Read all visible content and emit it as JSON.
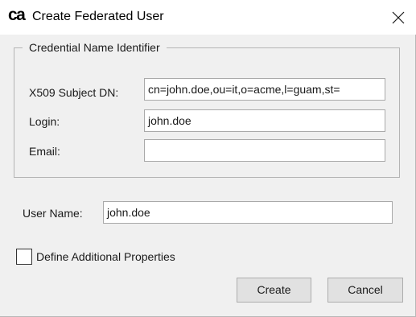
{
  "window": {
    "title": "Create Federated User",
    "logo_text": "ca",
    "close_icon": "close-icon"
  },
  "credential_group": {
    "legend": "Credential Name Identifier",
    "x509_label": "X509 Subject DN:",
    "x509_value": "cn=john.doe,ou=it,o=acme,l=guam,st=",
    "login_label": "Login:",
    "login_value": "john.doe",
    "email_label": "Email:",
    "email_value": ""
  },
  "user_name": {
    "label": "User Name:",
    "value": "john.doe"
  },
  "additional": {
    "label": "Define Additional Properties",
    "checked": false
  },
  "buttons": {
    "create": "Create",
    "cancel": "Cancel"
  }
}
